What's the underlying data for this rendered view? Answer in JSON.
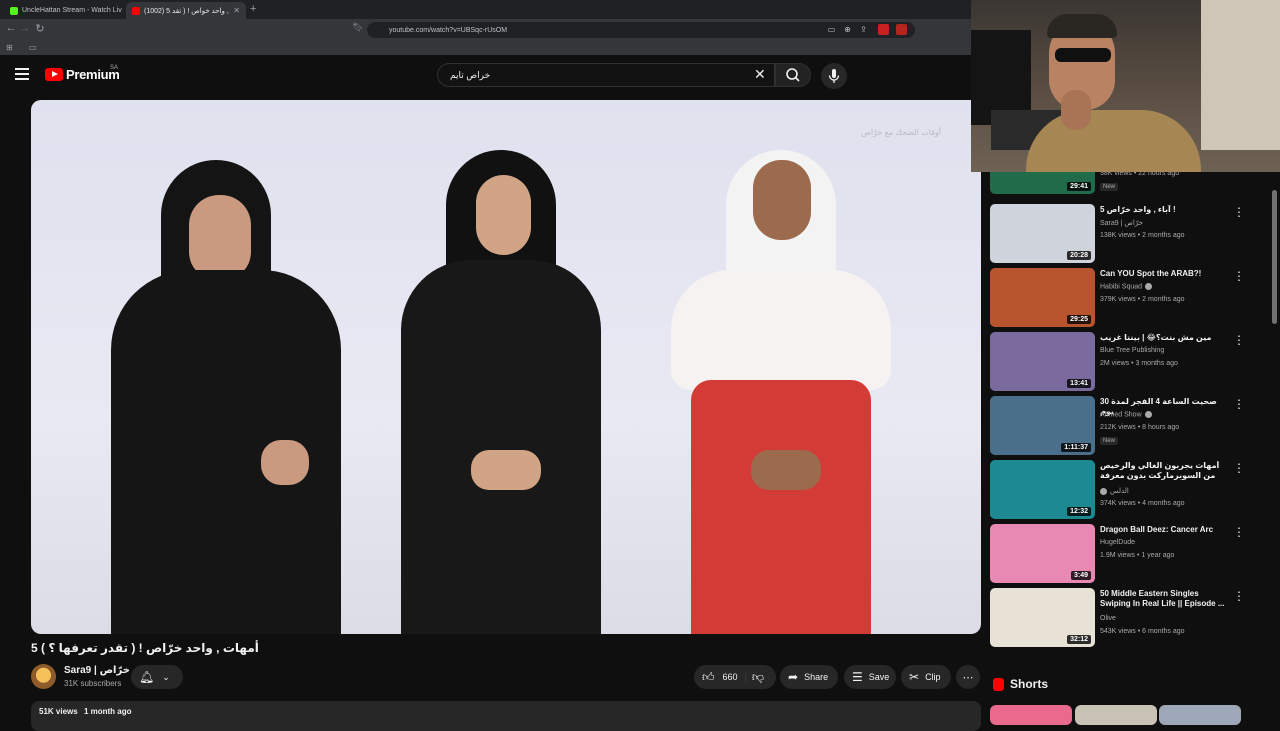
{
  "browser": {
    "tabs": [
      {
        "title": "UncleHattan Stream - Watch Liv"
      },
      {
        "title": "(1002) 5 أمهات , واحد خواص ! ( تقد"
      }
    ],
    "url": "youtube.com/watch?v=UBSqc-rUsOM"
  },
  "masthead": {
    "brand": "Premium",
    "region": "SA",
    "search_value": "خراص تايم"
  },
  "video": {
    "title": "5 أمهات , واحد خرّاص ! ( تقدر تعرفها ؟ )",
    "channel_name": "Sara9 | خرّاص",
    "subscribers": "31K subscribers",
    "likes": "660",
    "share_label": "Share",
    "save_label": "Save",
    "clip_label": "Clip",
    "views": "51K views",
    "age": "1 month ago"
  },
  "recommendations": [
    {
      "title": "",
      "channel": "",
      "meta": "38K views • 22 hours ago",
      "badge": "New",
      "duration": "29:41",
      "thumb_color": "#1f6b4a"
    },
    {
      "title": "5 آباء , واحد خرّاص !",
      "channel": "Sara9 | خرّاص",
      "meta": "138K views • 2 months ago",
      "badge": "",
      "duration": "20:28",
      "thumb_color": "#cfd3dc"
    },
    {
      "title": "Can YOU Spot the ARAB?!",
      "channel": "Habibi Squad",
      "meta": "379K views • 2 months ago",
      "badge": "",
      "duration": "29:25",
      "thumb_color": "#b8552f"
    },
    {
      "title": "مين مش بنت؟😂 | بيننا غريب",
      "channel": "Blue Tree Publishing",
      "meta": "2M views • 3 months ago",
      "badge": "",
      "duration": "13:41",
      "thumb_color": "#7b6a9e"
    },
    {
      "title": "صحيت الساعة 4 الفجر لمدة 30 يوم",
      "channel": "Ahmed Show",
      "meta": "212K views • 8 hours ago",
      "badge": "New",
      "duration": "1:11:37",
      "thumb_color": "#4a6f8a"
    },
    {
      "title": "أمهات يجربون الغالي والرخيص من السوبرماركت بدون معرفة السعر! | دلس ...",
      "channel": "الدلس",
      "meta": "374K views • 4 months ago",
      "badge": "",
      "duration": "12:32",
      "thumb_color": "#1d8a92"
    },
    {
      "title": "Dragon Ball Deez: Cancer Arc",
      "channel": "HugelDude",
      "meta": "1.9M views • 1 year ago",
      "badge": "",
      "duration": "3:49",
      "thumb_color": "#e889b3"
    },
    {
      "title": "50 Middle Eastern Singles Swiping In Real Life || Episode ...",
      "channel": "Olive",
      "meta": "543K views • 6 months ago",
      "badge": "",
      "duration": "32:12",
      "thumb_color": "#e7e1d6"
    }
  ],
  "shorts": {
    "label": "Shorts"
  },
  "player_overlay": {
    "watermark": "أوقات الضحك مع خرّاص"
  }
}
